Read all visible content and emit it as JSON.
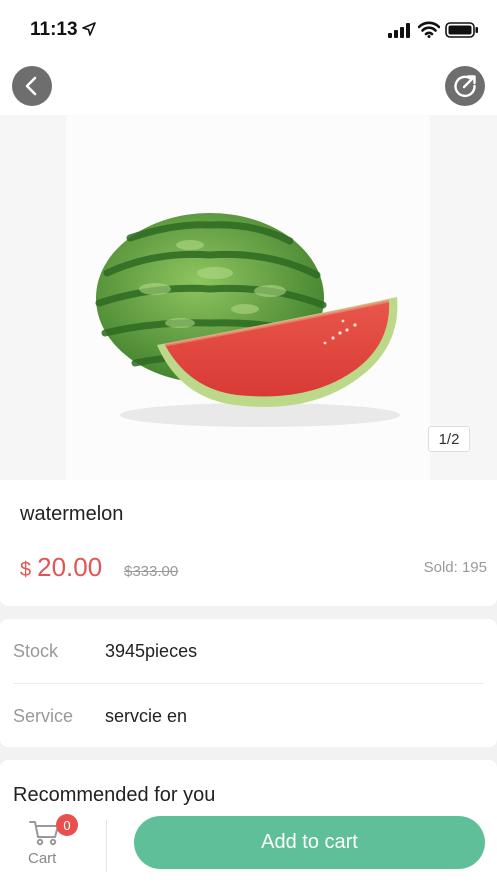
{
  "status_bar": {
    "time": "11:13"
  },
  "product": {
    "image_alt": "watermelon",
    "page_indicator": "1/2",
    "name": "watermelon",
    "price_symbol": "$",
    "price": "20.00",
    "original_price": "$333.00",
    "sold": "Sold: 195"
  },
  "details": {
    "stock_label": "Stock",
    "stock_value": "3945pieces",
    "service_label": "Service",
    "service_value": "servcie en"
  },
  "recommended": {
    "title": "Recommended for you"
  },
  "bottom_bar": {
    "cart_label": "Cart",
    "cart_count": "0",
    "add_to_cart_label": "Add to cart"
  },
  "colors": {
    "accent_green": "#5ebf98",
    "price_red": "#e25555",
    "badge_red": "#e8504d"
  },
  "icons": [
    "location-arrow-icon",
    "signal-icon",
    "wifi-icon",
    "battery-icon",
    "back-arrow-icon",
    "share-icon",
    "cart-icon"
  ]
}
